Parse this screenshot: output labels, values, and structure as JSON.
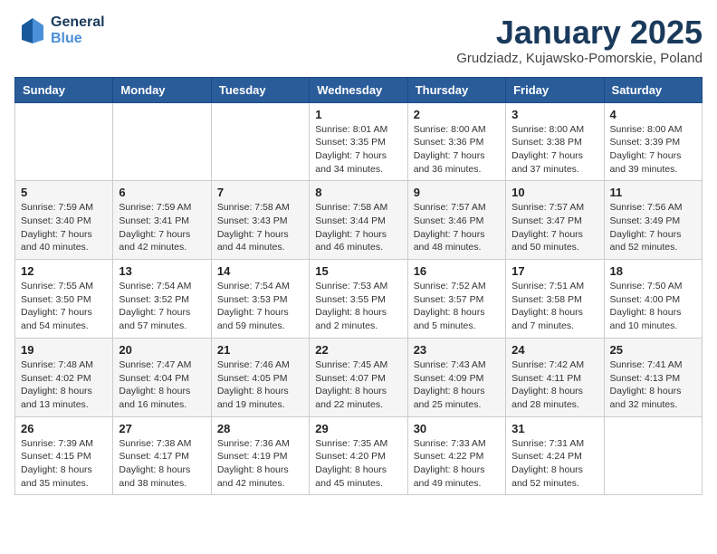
{
  "logo": {
    "line1": "General",
    "line2": "Blue"
  },
  "title": "January 2025",
  "subtitle": "Grudziadz, Kujawsko-Pomorskie, Poland",
  "weekdays": [
    "Sunday",
    "Monday",
    "Tuesday",
    "Wednesday",
    "Thursday",
    "Friday",
    "Saturday"
  ],
  "weeks": [
    [
      {
        "day": "",
        "sunrise": "",
        "sunset": "",
        "daylight": ""
      },
      {
        "day": "",
        "sunrise": "",
        "sunset": "",
        "daylight": ""
      },
      {
        "day": "",
        "sunrise": "",
        "sunset": "",
        "daylight": ""
      },
      {
        "day": "1",
        "sunrise": "Sunrise: 8:01 AM",
        "sunset": "Sunset: 3:35 PM",
        "daylight": "Daylight: 7 hours and 34 minutes."
      },
      {
        "day": "2",
        "sunrise": "Sunrise: 8:00 AM",
        "sunset": "Sunset: 3:36 PM",
        "daylight": "Daylight: 7 hours and 36 minutes."
      },
      {
        "day": "3",
        "sunrise": "Sunrise: 8:00 AM",
        "sunset": "Sunset: 3:38 PM",
        "daylight": "Daylight: 7 hours and 37 minutes."
      },
      {
        "day": "4",
        "sunrise": "Sunrise: 8:00 AM",
        "sunset": "Sunset: 3:39 PM",
        "daylight": "Daylight: 7 hours and 39 minutes."
      }
    ],
    [
      {
        "day": "5",
        "sunrise": "Sunrise: 7:59 AM",
        "sunset": "Sunset: 3:40 PM",
        "daylight": "Daylight: 7 hours and 40 minutes."
      },
      {
        "day": "6",
        "sunrise": "Sunrise: 7:59 AM",
        "sunset": "Sunset: 3:41 PM",
        "daylight": "Daylight: 7 hours and 42 minutes."
      },
      {
        "day": "7",
        "sunrise": "Sunrise: 7:58 AM",
        "sunset": "Sunset: 3:43 PM",
        "daylight": "Daylight: 7 hours and 44 minutes."
      },
      {
        "day": "8",
        "sunrise": "Sunrise: 7:58 AM",
        "sunset": "Sunset: 3:44 PM",
        "daylight": "Daylight: 7 hours and 46 minutes."
      },
      {
        "day": "9",
        "sunrise": "Sunrise: 7:57 AM",
        "sunset": "Sunset: 3:46 PM",
        "daylight": "Daylight: 7 hours and 48 minutes."
      },
      {
        "day": "10",
        "sunrise": "Sunrise: 7:57 AM",
        "sunset": "Sunset: 3:47 PM",
        "daylight": "Daylight: 7 hours and 50 minutes."
      },
      {
        "day": "11",
        "sunrise": "Sunrise: 7:56 AM",
        "sunset": "Sunset: 3:49 PM",
        "daylight": "Daylight: 7 hours and 52 minutes."
      }
    ],
    [
      {
        "day": "12",
        "sunrise": "Sunrise: 7:55 AM",
        "sunset": "Sunset: 3:50 PM",
        "daylight": "Daylight: 7 hours and 54 minutes."
      },
      {
        "day": "13",
        "sunrise": "Sunrise: 7:54 AM",
        "sunset": "Sunset: 3:52 PM",
        "daylight": "Daylight: 7 hours and 57 minutes."
      },
      {
        "day": "14",
        "sunrise": "Sunrise: 7:54 AM",
        "sunset": "Sunset: 3:53 PM",
        "daylight": "Daylight: 7 hours and 59 minutes."
      },
      {
        "day": "15",
        "sunrise": "Sunrise: 7:53 AM",
        "sunset": "Sunset: 3:55 PM",
        "daylight": "Daylight: 8 hours and 2 minutes."
      },
      {
        "day": "16",
        "sunrise": "Sunrise: 7:52 AM",
        "sunset": "Sunset: 3:57 PM",
        "daylight": "Daylight: 8 hours and 5 minutes."
      },
      {
        "day": "17",
        "sunrise": "Sunrise: 7:51 AM",
        "sunset": "Sunset: 3:58 PM",
        "daylight": "Daylight: 8 hours and 7 minutes."
      },
      {
        "day": "18",
        "sunrise": "Sunrise: 7:50 AM",
        "sunset": "Sunset: 4:00 PM",
        "daylight": "Daylight: 8 hours and 10 minutes."
      }
    ],
    [
      {
        "day": "19",
        "sunrise": "Sunrise: 7:48 AM",
        "sunset": "Sunset: 4:02 PM",
        "daylight": "Daylight: 8 hours and 13 minutes."
      },
      {
        "day": "20",
        "sunrise": "Sunrise: 7:47 AM",
        "sunset": "Sunset: 4:04 PM",
        "daylight": "Daylight: 8 hours and 16 minutes."
      },
      {
        "day": "21",
        "sunrise": "Sunrise: 7:46 AM",
        "sunset": "Sunset: 4:05 PM",
        "daylight": "Daylight: 8 hours and 19 minutes."
      },
      {
        "day": "22",
        "sunrise": "Sunrise: 7:45 AM",
        "sunset": "Sunset: 4:07 PM",
        "daylight": "Daylight: 8 hours and 22 minutes."
      },
      {
        "day": "23",
        "sunrise": "Sunrise: 7:43 AM",
        "sunset": "Sunset: 4:09 PM",
        "daylight": "Daylight: 8 hours and 25 minutes."
      },
      {
        "day": "24",
        "sunrise": "Sunrise: 7:42 AM",
        "sunset": "Sunset: 4:11 PM",
        "daylight": "Daylight: 8 hours and 28 minutes."
      },
      {
        "day": "25",
        "sunrise": "Sunrise: 7:41 AM",
        "sunset": "Sunset: 4:13 PM",
        "daylight": "Daylight: 8 hours and 32 minutes."
      }
    ],
    [
      {
        "day": "26",
        "sunrise": "Sunrise: 7:39 AM",
        "sunset": "Sunset: 4:15 PM",
        "daylight": "Daylight: 8 hours and 35 minutes."
      },
      {
        "day": "27",
        "sunrise": "Sunrise: 7:38 AM",
        "sunset": "Sunset: 4:17 PM",
        "daylight": "Daylight: 8 hours and 38 minutes."
      },
      {
        "day": "28",
        "sunrise": "Sunrise: 7:36 AM",
        "sunset": "Sunset: 4:19 PM",
        "daylight": "Daylight: 8 hours and 42 minutes."
      },
      {
        "day": "29",
        "sunrise": "Sunrise: 7:35 AM",
        "sunset": "Sunset: 4:20 PM",
        "daylight": "Daylight: 8 hours and 45 minutes."
      },
      {
        "day": "30",
        "sunrise": "Sunrise: 7:33 AM",
        "sunset": "Sunset: 4:22 PM",
        "daylight": "Daylight: 8 hours and 49 minutes."
      },
      {
        "day": "31",
        "sunrise": "Sunrise: 7:31 AM",
        "sunset": "Sunset: 4:24 PM",
        "daylight": "Daylight: 8 hours and 52 minutes."
      },
      {
        "day": "",
        "sunrise": "",
        "sunset": "",
        "daylight": ""
      }
    ]
  ]
}
